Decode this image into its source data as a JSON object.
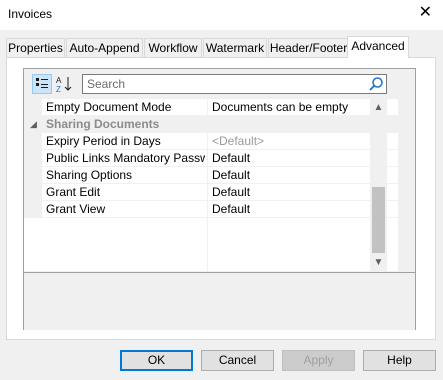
{
  "window": {
    "title": "Invoices",
    "close_glyph": "✕"
  },
  "tabs": [
    {
      "label": "Properties"
    },
    {
      "label": "Auto-Append"
    },
    {
      "label": "Workflow"
    },
    {
      "label": "Watermark"
    },
    {
      "label": "Header/Footer"
    },
    {
      "label": "Advanced"
    }
  ],
  "active_tab": "Advanced",
  "search": {
    "placeholder": "Search"
  },
  "toolbar": {
    "alpha_glyph_top": "A",
    "alpha_glyph_bottom": "Z"
  },
  "properties": {
    "row0": {
      "name": "Empty Document Mode",
      "value": "Documents can be empty"
    },
    "category": {
      "name": "Sharing Documents"
    },
    "row1": {
      "name": "Expiry Period in Days",
      "value": "<Default>"
    },
    "row2": {
      "name": "Public Links Mandatory Passw...",
      "value": "Default"
    },
    "row3": {
      "name": "Sharing Options",
      "value": "Default"
    },
    "row4": {
      "name": "Grant Edit",
      "value": "Default"
    },
    "row5": {
      "name": "Grant View",
      "value": "Default"
    }
  },
  "buttons": {
    "ok": "OK",
    "cancel": "Cancel",
    "apply": "Apply",
    "help": "Help"
  },
  "colors": {
    "accent": "#0078d7",
    "category_text": "#8c8c8c"
  }
}
